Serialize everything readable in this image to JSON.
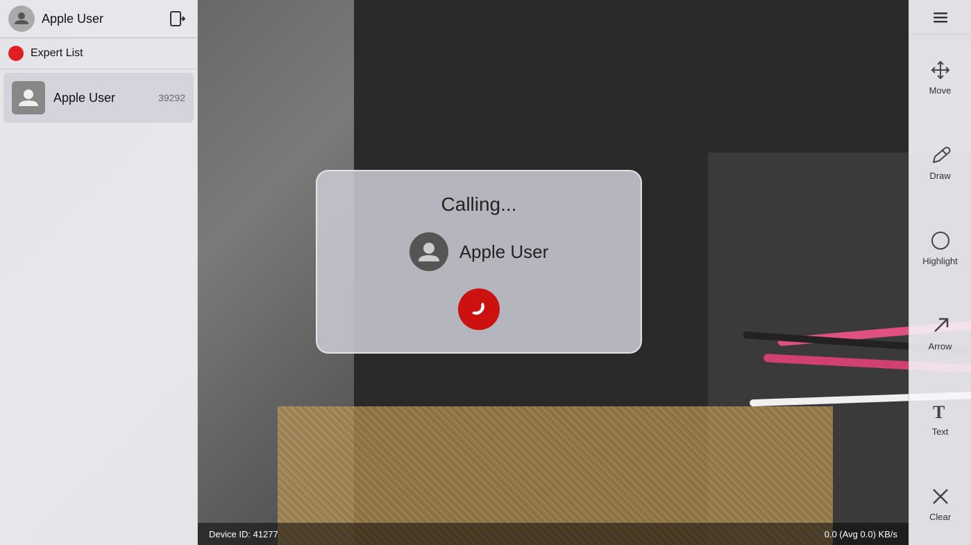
{
  "header": {
    "title": "Apple User",
    "logout_icon": "→□"
  },
  "expert_list": {
    "label": "Expert List"
  },
  "user": {
    "name": "Apple User",
    "id": "39292"
  },
  "calling_dialog": {
    "status": "Calling...",
    "username": "Apple User"
  },
  "toolbar": {
    "menu_icon": "≡",
    "move_label": "Move",
    "draw_label": "Draw",
    "highlight_label": "Highlight",
    "arrow_label": "Arrow",
    "text_label": "Text",
    "clear_label": "Clear"
  },
  "status_bar": {
    "device_id_label": "Device ID: 41277",
    "speed_label": "0.0 (Avg 0.0) KB/s"
  }
}
